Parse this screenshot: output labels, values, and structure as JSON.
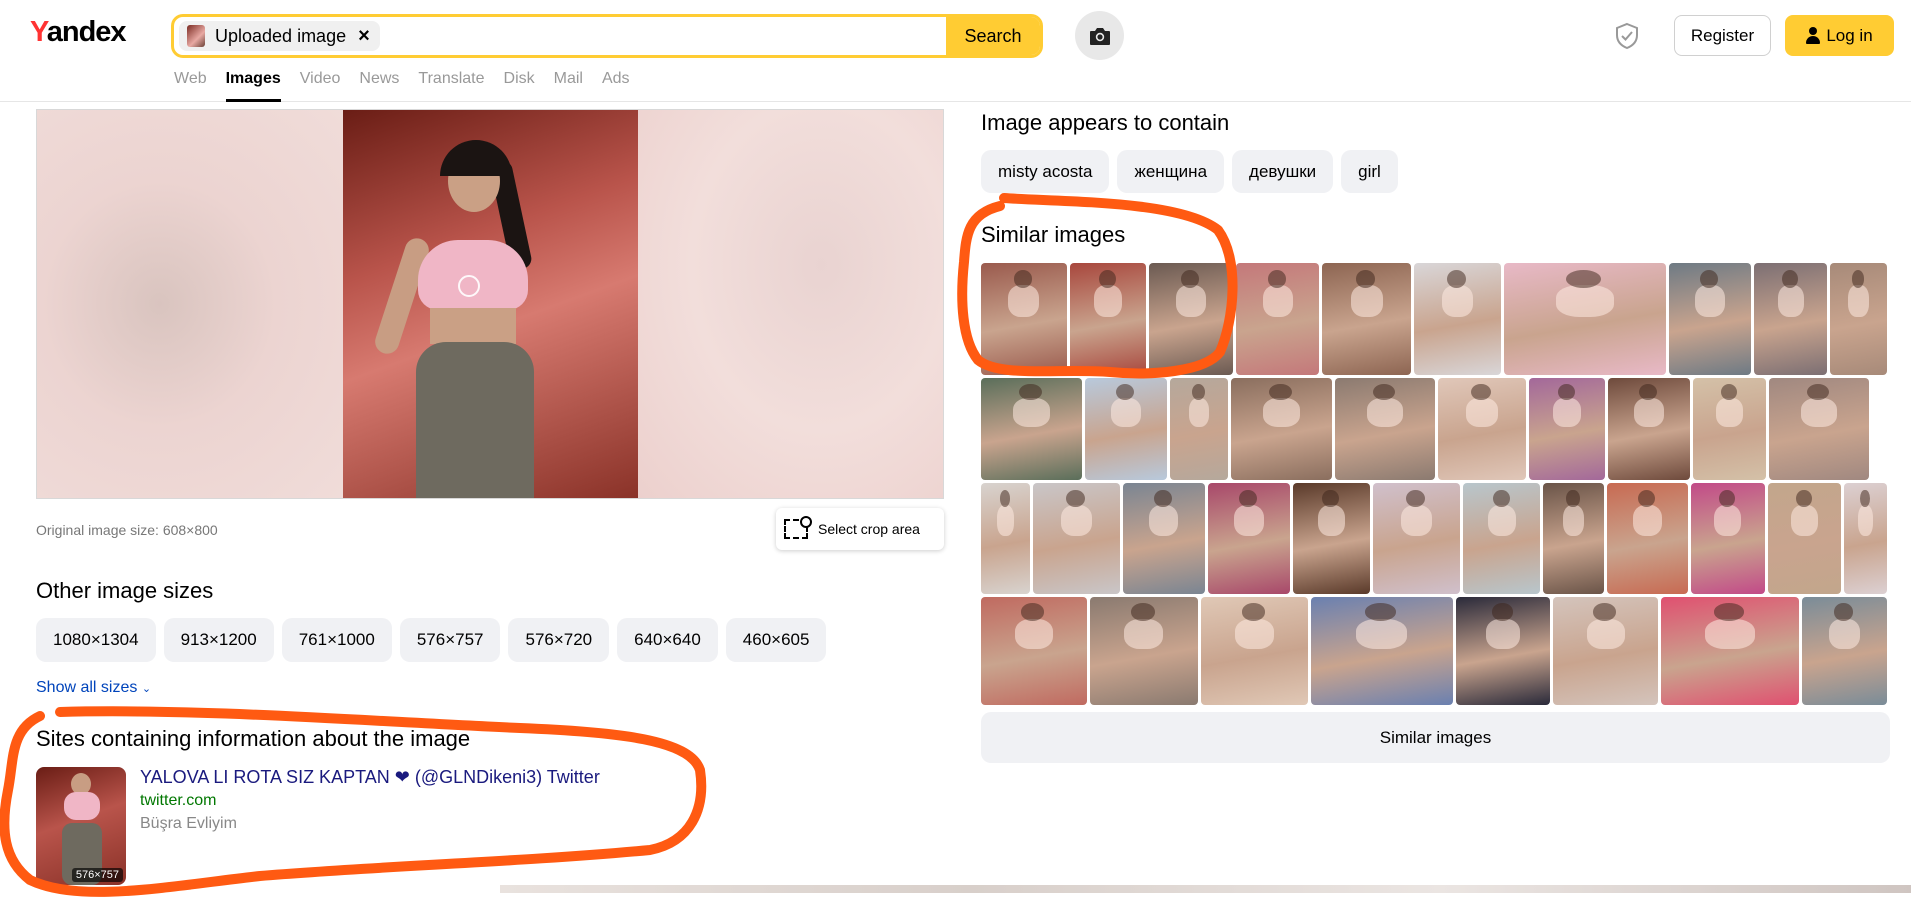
{
  "header": {
    "logo_first": "Y",
    "logo_rest": "andex",
    "uploaded_chip": "Uploaded image",
    "chip_close": "×",
    "search_button": "Search",
    "register": "Register",
    "login": "Log in",
    "nav": [
      "Web",
      "Images",
      "Video",
      "News",
      "Translate",
      "Disk",
      "Mail",
      "Ads"
    ],
    "nav_active": "Images"
  },
  "preview": {
    "original_size": "Original image size: 608×800",
    "crop_button": "Select crop area"
  },
  "other_sizes": {
    "title": "Other image sizes",
    "sizes": [
      "1080×1304",
      "913×1200",
      "761×1000",
      "576×757",
      "576×720",
      "640×640",
      "460×605"
    ],
    "show_all": "Show all sizes"
  },
  "sites": {
    "title": "Sites containing information about the image",
    "items": [
      {
        "title": "YALOVA LI ROTA SIZ KAPTAN ❤ (@GLNDikeni3) Twitter",
        "domain": "twitter.com",
        "description": "Büşra Evliyim",
        "thumb_size": "576×757"
      }
    ]
  },
  "contains": {
    "title": "Image appears to contain",
    "tags": [
      "misty acosta",
      "женщина",
      "девушки",
      "girl"
    ]
  },
  "similar": {
    "title": "Similar images",
    "button": "Similar images",
    "rows": [
      [
        "#9a5a4d",
        "#a8473d",
        "#6b5a52",
        "#c4787a",
        "#8d6552",
        "#d9d6d8",
        "#e8b9c7",
        "#6e7a84",
        "#7c6f73",
        "#a78a79"
      ],
      [
        "#5a6e5a",
        "#b8c9dc",
        "#b5a89c",
        "#8a6e5e",
        "#8b7a70",
        "#e0c7b9",
        "#a3689a",
        "#6e4a3c",
        "#d4c1a8",
        "#a08880"
      ],
      [
        "#d8d3cf",
        "#c9c6c8",
        "#7a8592",
        "#a8486a",
        "#5a3a2a",
        "#d0c0cc",
        "#b8c6cc",
        "#6a5448",
        "#c86a52",
        "#c24a88",
        "#c2a68c",
        "#dcd0d2"
      ],
      [
        "#c06a60",
        "#8a7a70",
        "#e0c8b6",
        "#6a80b0",
        "#2a2a3a",
        "#d4c4bc",
        "#e05070",
        "#7a8c98"
      ]
    ],
    "colors": {
      "accent": "#ffcc33",
      "annotation": "#ff5a12"
    }
  }
}
